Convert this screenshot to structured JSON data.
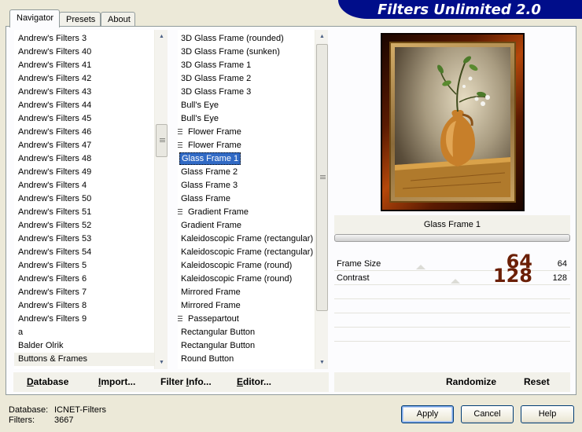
{
  "tabs": [
    "Navigator",
    "Presets",
    "About"
  ],
  "app_title": "Filters Unlimited 2.0",
  "categories": [
    "Andrew's Filters 3",
    "Andrew's Filters 40",
    "Andrew's Filters 41",
    "Andrew's Filters 42",
    "Andrew's Filters 43",
    "Andrew's Filters 44",
    "Andrew's Filters 45",
    "Andrew's Filters 46",
    "Andrew's Filters 47",
    "Andrew's Filters 48",
    "Andrew's Filters 49",
    "Andrew's Filters 4",
    "Andrew's Filters 50",
    "Andrew's Filters 51",
    "Andrew's Filters 52",
    "Andrew's Filters 53",
    "Andrew's Filters 54",
    "Andrew's Filters 5",
    "Andrew's Filters 6",
    "Andrew's Filters 7",
    "Andrew's Filters 8",
    "Andrew's Filters 9",
    "a",
    "Balder Olrik",
    "Buttons & Frames"
  ],
  "selected_category": "Buttons & Frames",
  "filters": [
    {
      "label": "3D Glass Frame (rounded)",
      "marked": false
    },
    {
      "label": "3D Glass Frame (sunken)",
      "marked": false
    },
    {
      "label": "3D Glass Frame 1",
      "marked": false
    },
    {
      "label": "3D Glass Frame 2",
      "marked": false
    },
    {
      "label": "3D Glass Frame 3",
      "marked": false
    },
    {
      "label": "Bull's Eye",
      "marked": false
    },
    {
      "label": "Bull's Eye",
      "marked": false
    },
    {
      "label": "Flower Frame",
      "marked": true
    },
    {
      "label": "Flower Frame",
      "marked": true
    },
    {
      "label": "Glass Frame 1",
      "marked": false,
      "selected": true
    },
    {
      "label": "Glass Frame 2",
      "marked": false
    },
    {
      "label": "Glass Frame 3",
      "marked": false
    },
    {
      "label": "Glass Frame",
      "marked": false
    },
    {
      "label": "Gradient Frame",
      "marked": true
    },
    {
      "label": "Gradient Frame",
      "marked": false
    },
    {
      "label": "Kaleidoscopic Frame (rectangular)",
      "marked": false
    },
    {
      "label": "Kaleidoscopic Frame (rectangular)",
      "marked": false
    },
    {
      "label": "Kaleidoscopic Frame (round)",
      "marked": false
    },
    {
      "label": "Kaleidoscopic Frame (round)",
      "marked": false
    },
    {
      "label": "Mirrored Frame",
      "marked": false
    },
    {
      "label": "Mirrored Frame",
      "marked": false
    },
    {
      "label": "Passepartout",
      "marked": true
    },
    {
      "label": "Rectangular Button",
      "marked": false
    },
    {
      "label": "Rectangular Button",
      "marked": false
    },
    {
      "label": "Round Button",
      "marked": false
    }
  ],
  "list_buttons": {
    "database": {
      "accel": "D",
      "rest": "atabase"
    },
    "import": {
      "accel": "I",
      "rest": "mport..."
    },
    "filter_info": {
      "pre": "Filter ",
      "accel": "I",
      "rest": "nfo..."
    },
    "editor": {
      "accel": "E",
      "rest": "ditor..."
    }
  },
  "preview_label": "Glass Frame 1",
  "params": [
    {
      "name": "Frame Size",
      "value": "64",
      "slider": 0.25
    },
    {
      "name": "Contrast",
      "value": "128",
      "slider": 0.5
    }
  ],
  "param_buttons": {
    "randomize": "Randomize",
    "reset": "Reset"
  },
  "footer": {
    "database_label": "Database:",
    "database_value": "ICNET-Filters",
    "filters_label": "Filters:",
    "filters_value": "3667"
  },
  "buttons": {
    "apply": "Apply",
    "cancel": "Cancel",
    "help": "Help"
  },
  "colors": {
    "selection": "#316ac5",
    "banner": "#000d8a",
    "big_value": "#6b1f06"
  }
}
